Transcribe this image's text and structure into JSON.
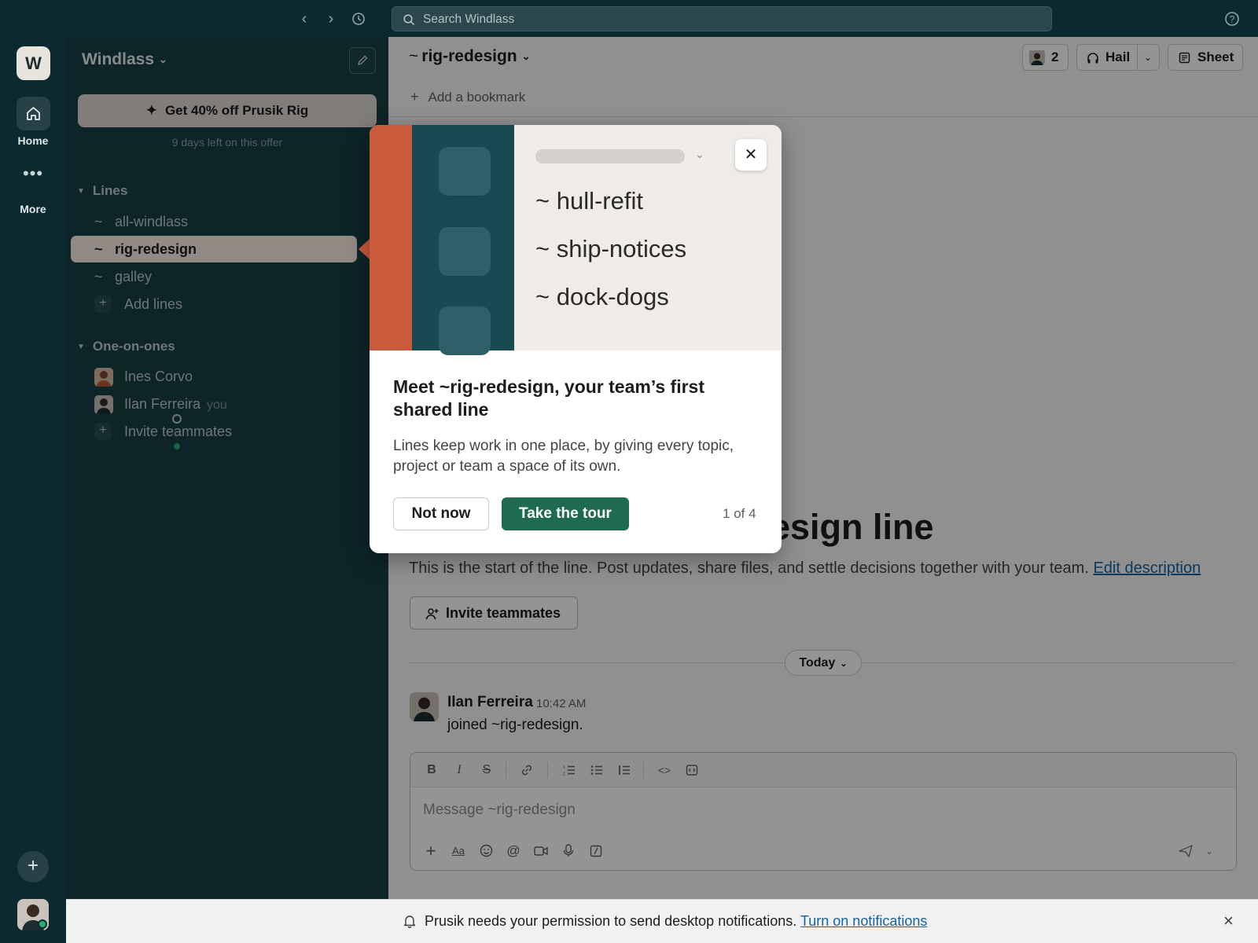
{
  "topbar": {
    "search_placeholder": "Search Windlass"
  },
  "rail": {
    "workspace_initial": "W",
    "home_label": "Home",
    "more_label": "More"
  },
  "sidebar": {
    "workspace_name": "Windlass",
    "promo_label": "Get 40% off Prusik Rig",
    "promo_sub": "9 days left on this offer",
    "lines_header": "Lines",
    "lines": [
      {
        "label": "all-windlass"
      },
      {
        "label": "rig-redesign"
      },
      {
        "label": "galley"
      }
    ],
    "add_lines": "Add lines",
    "dm_header": "One-on-ones",
    "dms": [
      {
        "label": "Ines Corvo"
      },
      {
        "label": "Ilan Ferreira",
        "suffix": "you"
      }
    ],
    "invite_label": "Invite teammates"
  },
  "main": {
    "channel_name": "rig-redesign",
    "member_count": "2",
    "hail_label": "Hail",
    "sheet_label": "Sheet",
    "bookmark_label": "Add a bookmark",
    "big_title_visible": "esign line",
    "intro_text": "This is the start of the line. Post updates, share files, and settle decisions together with your team.",
    "edit_description": "Edit description",
    "invite_button": "Invite teammates",
    "day_divider": "Today",
    "message": {
      "author": "Ilan Ferreira",
      "time": "10:42 AM",
      "text": "joined ~rig-redesign."
    },
    "composer_placeholder": "Message ~rig-redesign"
  },
  "notification": {
    "text": "Prusik needs your permission to send desktop notifications.",
    "link": "Turn on notifications"
  },
  "popover": {
    "hero_items": [
      "hull-refit",
      "ship-notices",
      "dock-dogs"
    ],
    "title": "Meet ~rig-redesign, your team’s first shared line",
    "body": "Lines keep work in one place, by giving every topic, project or team a space of its own.",
    "not_now": "Not now",
    "take_tour": "Take the tour",
    "step": "1 of 4"
  },
  "colors": {
    "rail_bg": "#0b2a30",
    "sidebar_bg": "#173f46",
    "active_item_bg": "#fbeee6",
    "accent_green": "#1e6b52",
    "hero_orange": "#c95a3c",
    "link_blue": "#1264a3"
  }
}
